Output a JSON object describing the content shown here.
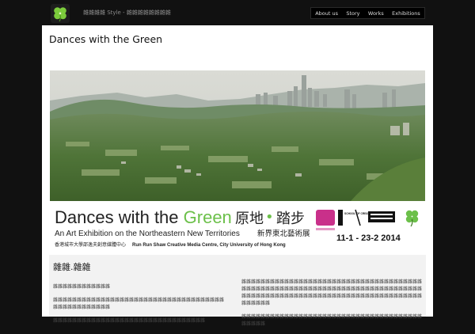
{
  "header": {
    "tagline": "雜雜雜雜 Style - 雜雜雜雜雜雜雜雜",
    "nav": [
      {
        "label": "About us"
      },
      {
        "label": "Story"
      },
      {
        "label": "Works"
      },
      {
        "label": "Exhibitions"
      }
    ]
  },
  "page": {
    "title": "Dances with the Green"
  },
  "banner": {
    "headline_part1": "Dances with the ",
    "headline_part2": "Green",
    "headline_cjk_1": "原地",
    "headline_cjk_dot": "•",
    "headline_cjk_2": "踏步",
    "subtitle": "An Art Exhibition on the Northeastern New Territories",
    "subtitle_cjk": "新界東北藝術展",
    "venue_cjk": "香港城市大學邵逸夫創意媒體中心",
    "venue": "Run Run Shaw Creative Media Centre,  City University of Hong Kong",
    "dates": "11-1 - 23-2 2014",
    "logo_school": "SCHOOL OF CREATIVE MEDIA"
  },
  "content": {
    "heading": "雜雜.雜雜",
    "left_paragraphs": [
      "雜雜雜雜雜雜雜雜雜雜雜雜",
      "雜雜雜雜雜雜雜雜雜雜雜雜雜雜雜雜雜雜雜雜雜雜雜雜雜雜雜雜雜雜雜雜雜雜雜雜雜雜雜雜雜雜雜雜雜雜雜雜",
      "雜雜雜雜雜雜雜雜雜雜雜雜雜雜雜雜雜雜雜雜雜雜雜雜雜雜雜雜雜雜雜雜"
    ],
    "right_paragraphs": [
      "雜雜雜雜雜雜雜雜雜雜雜雜雜雜雜雜雜雜雜雜雜雜雜雜雜雜雜雜雜雜雜雜雜雜雜雜雜雜雜雜雜雜雜雜雜雜雜雜雜雜雜雜雜雜雜雜雜雜雜雜雜雜雜雜雜雜雜雜雜雜雜雜雜雜雜雜雜雜雜雜雜雜雜雜雜雜雜雜雜雜雜雜雜雜雜雜雜雜雜雜雜雜雜雜雜雜雜雜雜雜雜雜雜雜雜雜雜雜雜雜",
      "雜雜雜雜雜雜雜雜雜雜雜雜雜雜雜雜雜雜雜雜雜雜雜雜雜雜雜雜雜雜雜雜雜雜雜雜雜雜雜雜雜雜雜"
    ]
  },
  "colors": {
    "page_background": "#111111",
    "accent_green": "#6cc04a",
    "pink": "#c9308a"
  }
}
